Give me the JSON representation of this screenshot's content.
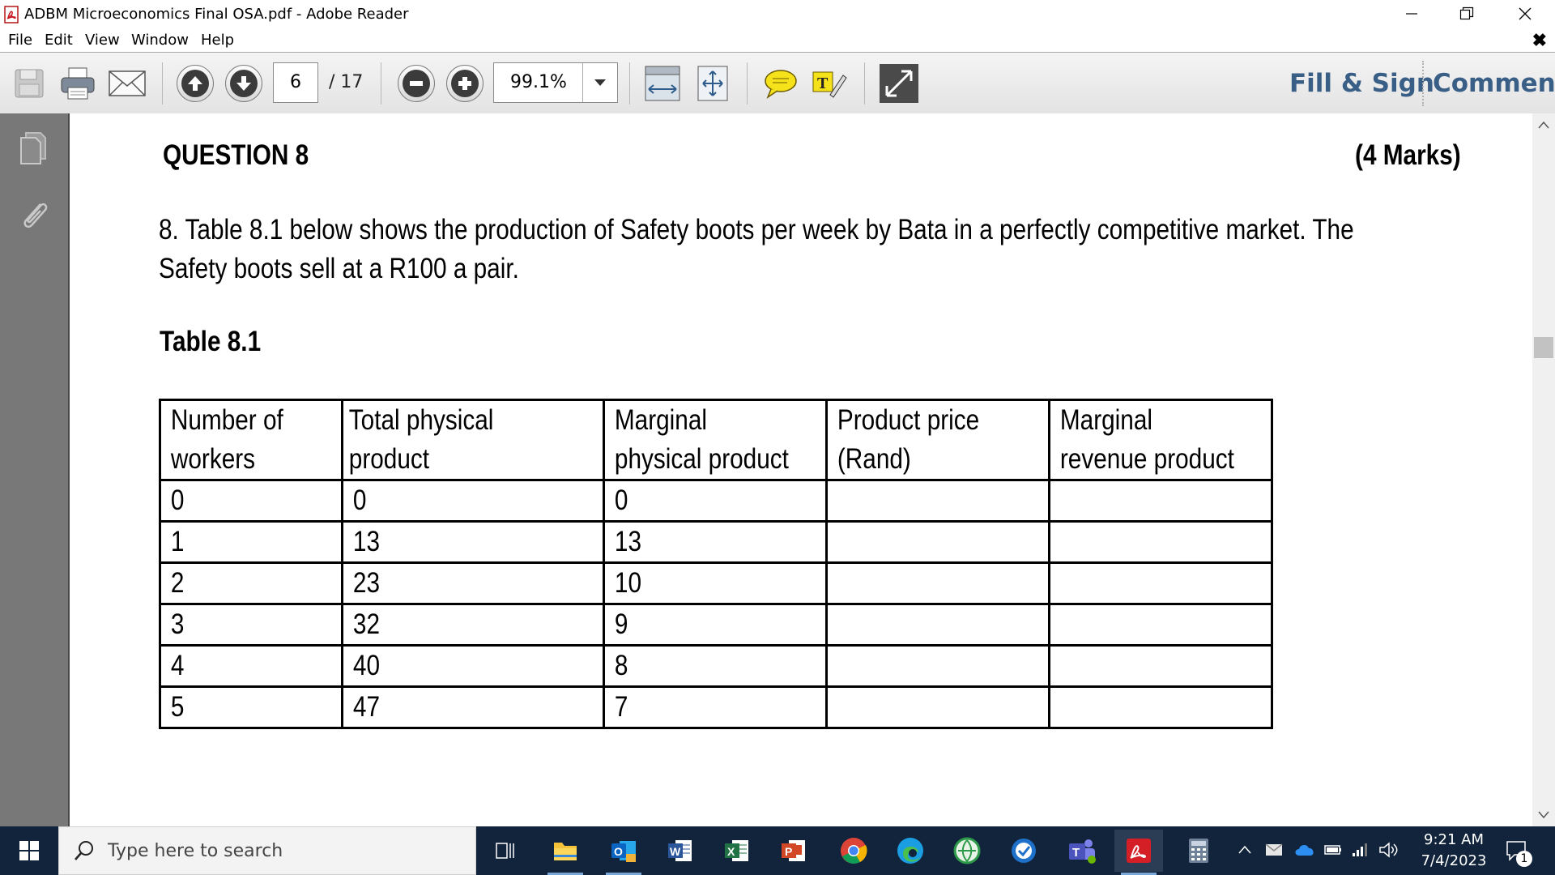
{
  "window": {
    "title": "ADBM Microeconomics Final OSA.pdf - Adobe Reader"
  },
  "menu": [
    "File",
    "Edit",
    "View",
    "Window",
    "Help"
  ],
  "toolbar": {
    "current_page": "6",
    "page_total": "/ 17",
    "zoom": "99.1%",
    "fill_sign_label": "Fill & Sign",
    "comment_label": "Comment"
  },
  "document": {
    "question_title": "QUESTION 8",
    "marks": "(4 Marks)",
    "paragraph": "8. Table 8.1 below shows the production of Safety boots per week by Bata in a perfectly competitive market. The Safety boots sell at a R100 a pair.",
    "table_caption": "Table 8.1",
    "table": {
      "headers": [
        "Number of workers",
        "Total physical product",
        "Marginal physical product",
        "Product price (Rand)",
        "Marginal revenue product"
      ],
      "rows": [
        [
          "0",
          "0",
          "0",
          "",
          ""
        ],
        [
          "1",
          "13",
          "13",
          "",
          ""
        ],
        [
          "2",
          "23",
          "10",
          "",
          ""
        ],
        [
          "3",
          "32",
          "9",
          "",
          ""
        ],
        [
          "4",
          "40",
          "8",
          "",
          ""
        ],
        [
          "5",
          "47",
          "7",
          "",
          ""
        ]
      ]
    }
  },
  "taskbar": {
    "search_placeholder": "Type here to search",
    "time": "9:21 AM",
    "date": "7/4/2023",
    "notification_count": "1"
  },
  "colors": {
    "link_blue": "#3a5f86",
    "taskbar_bg": "#11243b",
    "nav_panel": "#787878"
  }
}
